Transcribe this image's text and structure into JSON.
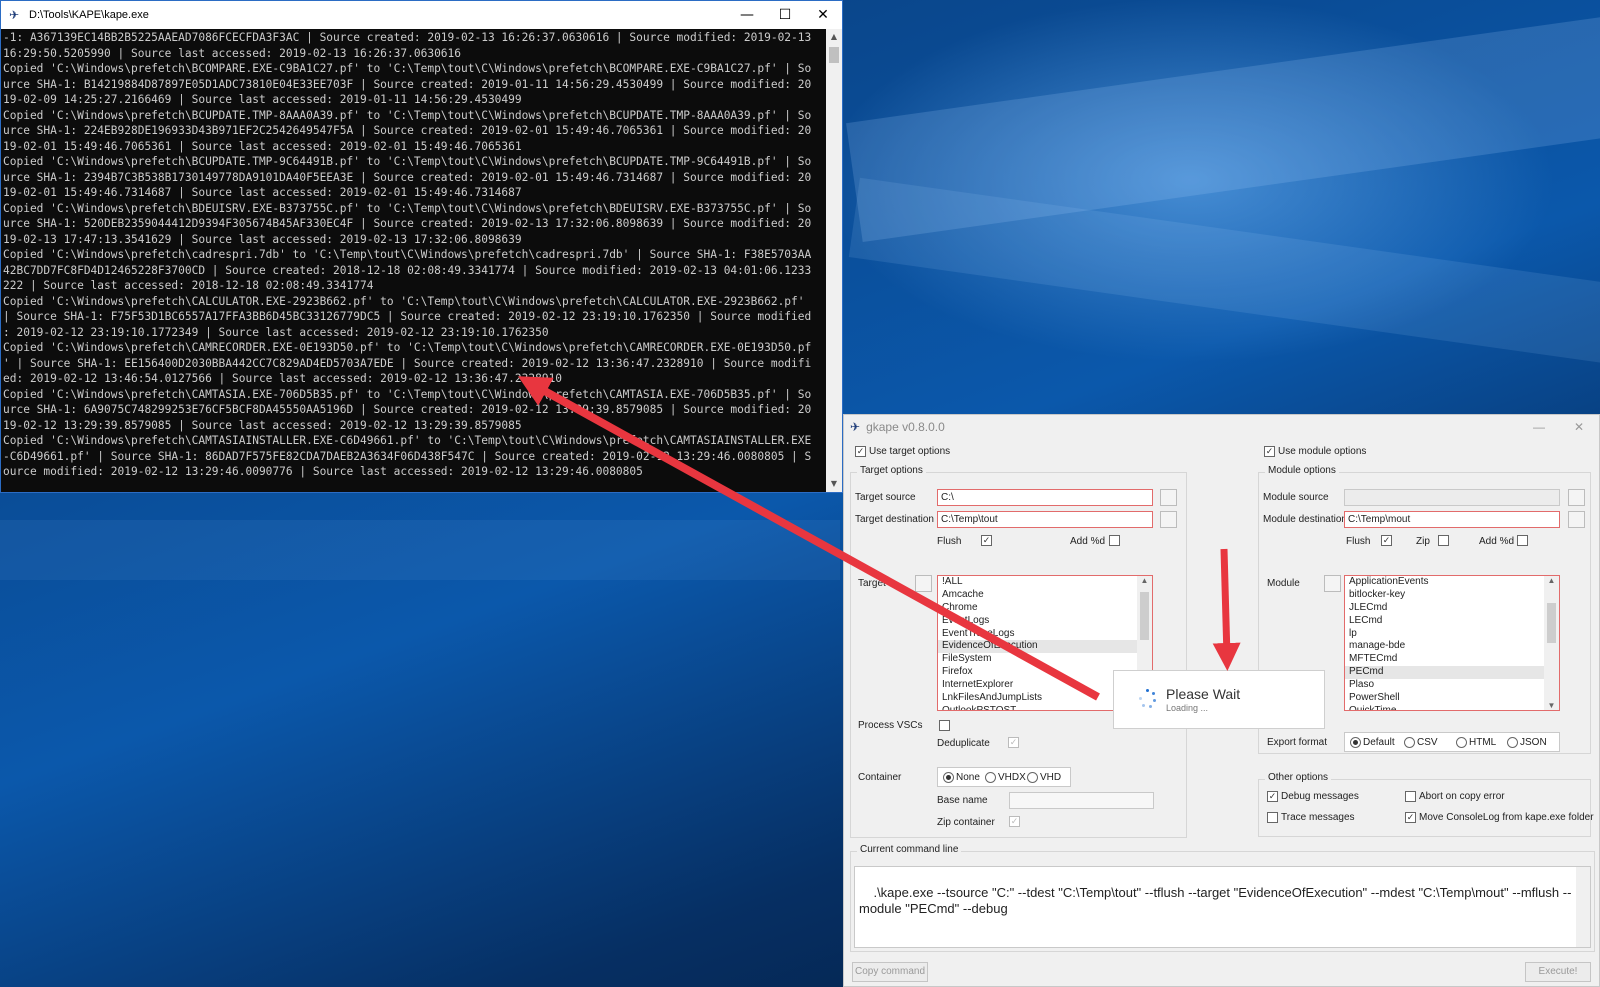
{
  "console": {
    "title": "D:\\Tools\\KAPE\\kape.exe",
    "minimize": "—",
    "maximize": "☐",
    "close": "✕",
    "lines": [
      "-1: A367139EC14BB2B5225AAEAD7086FCECFDA3F3AC | Source created: 2019-02-13 16:26:37.0630616 | Source modified: 2019-02-13",
      "16:29:50.5205990 | Source last accessed: 2019-02-13 16:26:37.0630616",
      "Copied 'C:\\Windows\\prefetch\\BCOMPARE.EXE-C9BA1C27.pf' to 'C:\\Temp\\tout\\C\\Windows\\prefetch\\BCOMPARE.EXE-C9BA1C27.pf' | So",
      "urce SHA-1: B14219884D87897E05D1ADC73810E04E33EE703F | Source created: 2019-01-11 14:56:29.4530499 | Source modified: 20",
      "19-02-09 14:25:27.2166469 | Source last accessed: 2019-01-11 14:56:29.4530499",
      "Copied 'C:\\Windows\\prefetch\\BCUPDATE.TMP-8AAA0A39.pf' to 'C:\\Temp\\tout\\C\\Windows\\prefetch\\BCUPDATE.TMP-8AAA0A39.pf' | So",
      "urce SHA-1: 224EB928DE196933D43B971EF2C2542649547F5A | Source created: 2019-02-01 15:49:46.7065361 | Source modified: 20",
      "19-02-01 15:49:46.7065361 | Source last accessed: 2019-02-01 15:49:46.7065361",
      "Copied 'C:\\Windows\\prefetch\\BCUPDATE.TMP-9C64491B.pf' to 'C:\\Temp\\tout\\C\\Windows\\prefetch\\BCUPDATE.TMP-9C64491B.pf' | So",
      "urce SHA-1: 2394B7C3B538B1730149778DA9101DA40F5EEA3E | Source created: 2019-02-01 15:49:46.7314687 | Source modified: 20",
      "19-02-01 15:49:46.7314687 | Source last accessed: 2019-02-01 15:49:46.7314687",
      "Copied 'C:\\Windows\\prefetch\\BDEUISRV.EXE-B373755C.pf' to 'C:\\Temp\\tout\\C\\Windows\\prefetch\\BDEUISRV.EXE-B373755C.pf' | So",
      "urce SHA-1: 520DEB2359044412D9394F305674B45AF330EC4F | Source created: 2019-02-13 17:32:06.8098639 | Source modified: 20",
      "19-02-13 17:47:13.3541629 | Source last accessed: 2019-02-13 17:32:06.8098639",
      "Copied 'C:\\Windows\\prefetch\\cadrespri.7db' to 'C:\\Temp\\tout\\C\\Windows\\prefetch\\cadrespri.7db' | Source SHA-1: F38E5703AA",
      "42BC7DD7FC8FD4D12465228F3700CD | Source created: 2018-12-18 02:08:49.3341774 | Source modified: 2019-02-13 04:01:06.1233",
      "222 | Source last accessed: 2018-12-18 02:08:49.3341774",
      "Copied 'C:\\Windows\\prefetch\\CALCULATOR.EXE-2923B662.pf' to 'C:\\Temp\\tout\\C\\Windows\\prefetch\\CALCULATOR.EXE-2923B662.pf'",
      "| Source SHA-1: F75F53D1BC6557A17FFA3BB6D45BC33126779DC5 | Source created: 2019-02-12 23:19:10.1762350 | Source modified",
      ": 2019-02-12 23:19:10.1772349 | Source last accessed: 2019-02-12 23:19:10.1762350",
      "Copied 'C:\\Windows\\prefetch\\CAMRECORDER.EXE-0E193D50.pf' to 'C:\\Temp\\tout\\C\\Windows\\prefetch\\CAMRECORDER.EXE-0E193D50.pf",
      "' | Source SHA-1: EE156400D2030BBA442CC7C829AD4ED5703A7EDE | Source created: 2019-02-12 13:36:47.2328910 | Source modifi",
      "ed: 2019-02-12 13:46:54.0127566 | Source last accessed: 2019-02-12 13:36:47.2328910",
      "Copied 'C:\\Windows\\prefetch\\CAMTASIA.EXE-706D5B35.pf' to 'C:\\Temp\\tout\\C\\Windows\\prefetch\\CAMTASIA.EXE-706D5B35.pf' | So",
      "urce SHA-1: 6A9075C748299253E76CF5BCF8DA45550AA5196D | Source created: 2019-02-12 13:29:39.8579085 | Source modified: 20",
      "19-02-12 13:29:39.8579085 | Source last accessed: 2019-02-12 13:29:39.8579085",
      "Copied 'C:\\Windows\\prefetch\\CAMTASIAINSTALLER.EXE-C6D49661.pf' to 'C:\\Temp\\tout\\C\\Windows\\prefetch\\CAMTASIAINSTALLER.EXE",
      "-C6D49661.pf' | Source SHA-1: 86DAD7F575FE82CDA7DAEB2A3634F06D438F547C | Source created: 2019-02-12 13:29:46.0080805 | S",
      "ource modified: 2019-02-12 13:29:46.0090776 | Source last accessed: 2019-02-12 13:29:46.0080805"
    ]
  },
  "gkape": {
    "title": "gkape v0.8.0.0",
    "minimize": "—",
    "close": "✕",
    "use_target_options": "Use target options",
    "use_module_options": "Use module options",
    "target_options_group": "Target options",
    "module_options_group": "Module options",
    "target_source_label": "Target source",
    "target_source_value": "C:\\",
    "target_destination_label": "Target destination",
    "target_destination_value": "C:\\Temp\\tout",
    "flush_label": "Flush",
    "add_d_label": "Add %d",
    "target_label": "Target",
    "target_items": [
      "!ALL",
      "Amcache",
      "Chrome",
      "EventLogs",
      "EventTraceLogs",
      "EvidenceOfExecution",
      "FileSystem",
      "Firefox",
      "InternetExplorer",
      "LnkFilesAndJumpLists",
      "OutlookPSTOST"
    ],
    "target_selected": "EvidenceOfExecution",
    "process_vscs_label": "Process VSCs",
    "deduplicate_label": "Deduplicate",
    "container_label": "Container",
    "container_options": [
      "None",
      "VHDX",
      "VHD"
    ],
    "container_selected": "None",
    "base_name_label": "Base name",
    "zip_container_label": "Zip container",
    "module_source_label": "Module source",
    "module_destination_label": "Module destination",
    "module_destination_value": "C:\\Temp\\mout",
    "module_flush_label": "Flush",
    "zip_label": "Zip",
    "module_add_d_label": "Add %d",
    "module_label": "Module",
    "module_items": [
      "ApplicationEvents",
      "bitlocker-key",
      "JLECmd",
      "LECmd",
      "lp",
      "manage-bde",
      "MFTECmd",
      "PECmd",
      "Plaso",
      "PowerShell",
      "QuickTime"
    ],
    "module_selected": "PECmd",
    "export_format_label": "Export format",
    "export_formats": [
      "Default",
      "CSV",
      "HTML",
      "JSON"
    ],
    "export_selected": "Default",
    "other_options_group": "Other options",
    "debug_messages": "Debug messages",
    "abort_on_copy_error": "Abort on copy error",
    "trace_messages": "Trace messages",
    "move_consolelog": "Move ConsoleLog from kape.exe folder",
    "current_command_line_group": "Current command line",
    "command_line": ".\\kape.exe --tsource \"C:\" --tdest \"C:\\Temp\\tout\" --tflush --target \"EvidenceOfExecution\" --mdest \"C:\\Temp\\mout\" --mflush --module \"PECmd\" --debug",
    "copy_command": "Copy command",
    "execute": "Execute!"
  },
  "popup": {
    "title": "Please Wait",
    "subtitle": "Loading ..."
  },
  "colors": {
    "arrow": "#e8363f",
    "field_border_required": "#e26b6b",
    "console_bg": "#0c0c0c",
    "console_text": "#cccccc"
  }
}
